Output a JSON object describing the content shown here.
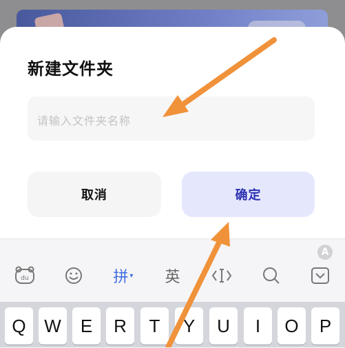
{
  "dialog": {
    "title": "新建文件夹",
    "input": {
      "placeholder": "请输入文件夹名称",
      "value": ""
    },
    "cancel_label": "取消",
    "confirm_label": "确定"
  },
  "keyboard": {
    "toolbar": [
      {
        "name": "baidu-input-icon",
        "glyph": "du",
        "active": false
      },
      {
        "name": "emoji-icon",
        "glyph": "☺",
        "active": false
      },
      {
        "name": "pinyin-mode",
        "glyph": "拼",
        "active": true
      },
      {
        "name": "english-mode",
        "glyph": "英",
        "active": false
      },
      {
        "name": "cursor-move-icon",
        "glyph": "‹I›",
        "active": false
      },
      {
        "name": "search-icon",
        "glyph": "⌕",
        "active": false
      },
      {
        "name": "hide-keyboard-icon",
        "glyph": "⌄",
        "active": false
      }
    ],
    "keys": [
      "Q",
      "W",
      "E",
      "R",
      "T",
      "Y",
      "U",
      "I",
      "O",
      "P"
    ]
  },
  "colors": {
    "accent": "#3d6be0",
    "confirm_bg": "#e5e8fd",
    "confirm_text": "#2b2fb0",
    "arrow": "#f0923a"
  }
}
